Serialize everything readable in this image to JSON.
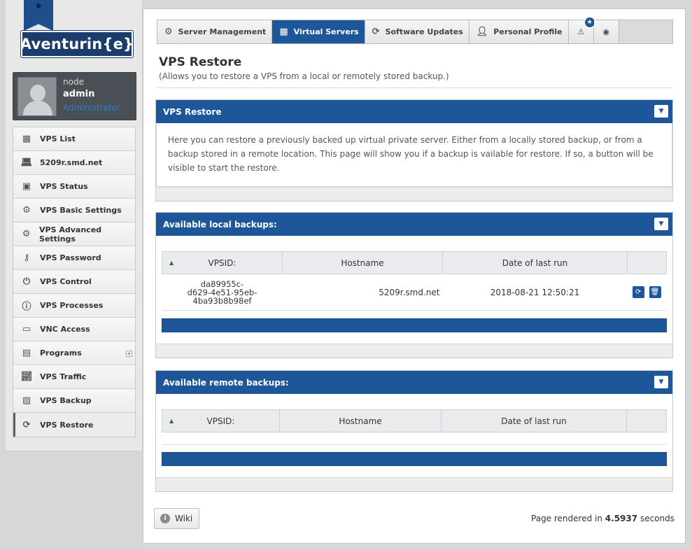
{
  "brand": {
    "logo_text": "Aventurin{e}"
  },
  "user": {
    "node": "node",
    "name": "admin",
    "role": "Administrator"
  },
  "sidebar": {
    "items": [
      {
        "label": "VPS List",
        "icon": "list-icon"
      },
      {
        "label": "5209r.smd.net",
        "icon": "laptop-icon"
      },
      {
        "label": "VPS Status",
        "icon": "toolbox-icon"
      },
      {
        "label": "VPS Basic Settings",
        "icon": "gear-icon"
      },
      {
        "label": "VPS Advanced Settings",
        "icon": "gears-icon"
      },
      {
        "label": "VPS Password",
        "icon": "key-icon"
      },
      {
        "label": "VPS Control",
        "icon": "plug-icon"
      },
      {
        "label": "VPS Processes",
        "icon": "info-icon"
      },
      {
        "label": "VNC Access",
        "icon": "monitor-icon"
      },
      {
        "label": "Programs",
        "icon": "chip-icon"
      },
      {
        "label": "VPS Traffic",
        "icon": "chart-icon"
      },
      {
        "label": "VPS Backup",
        "icon": "backup-icon"
      },
      {
        "label": "VPS Restore",
        "icon": "refresh-icon"
      }
    ]
  },
  "topnav": {
    "tabs": [
      {
        "label": "Server Management",
        "icon": "gear-icon"
      },
      {
        "label": "Virtual Servers",
        "icon": "grid-icon"
      },
      {
        "label": "Software Updates",
        "icon": "refresh-icon"
      },
      {
        "label": "Personal Profile",
        "icon": "user-icon"
      }
    ],
    "alert_icon": "warning-icon",
    "help_icon": "lifebuoy-icon",
    "badge_icon": "star-icon"
  },
  "page": {
    "title": "VPS Restore",
    "subtitle": "(Allows you to restore a VPS from a local or remotely stored backup.)"
  },
  "intro_panel": {
    "title": "VPS Restore",
    "text": "Here you can restore a previously backed up virtual private server. Either from a locally stored backup, or from a backup stored in a remote location. This page will show you if a backup is vailable for restore. If so, a button will be visible to start the restore."
  },
  "local_panel": {
    "title": "Available local backups:",
    "columns": [
      "VPSID:",
      "Hostname",
      "Date of last run",
      ""
    ],
    "rows": [
      {
        "vpsid_line1": "da89955c-",
        "vpsid_line2": "d629-4e51-95eb-",
        "vpsid_line3": "4ba93b8b98ef",
        "hostname": "5209r.smd.net",
        "date": "2018-08-21 12:50:21"
      }
    ]
  },
  "remote_panel": {
    "title": "Available remote backups:",
    "columns": [
      "VPSID:",
      "Hostname",
      "Date of last run",
      ""
    ]
  },
  "footer": {
    "wiki_label": "Wiki",
    "render_prefix": "Page rendered in",
    "render_time": "4.5937",
    "render_suffix": "seconds"
  }
}
